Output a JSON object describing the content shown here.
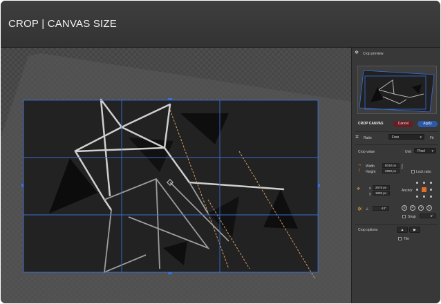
{
  "header": {
    "title": "CROP | CANVAS SIZE"
  },
  "panel": {
    "crop_preview_label": "Crop preview",
    "crop_canvas_label": "CROP CANVAS",
    "cancel_label": "Cancel",
    "apply_label": "Apply",
    "ratio_label": "Ratio",
    "ratio_value": "Free",
    "fit_label": "Fit",
    "crop_value_label": "Crop value",
    "unit_label": "Unit",
    "unit_value": "Pixel",
    "width_label": "Width",
    "width_value": "5010 px",
    "height_label": "Height",
    "height_value": "2980 px",
    "lock_ratio_label": "Lock ratio",
    "x_label": "x",
    "x_value": "2575 px",
    "y_label": "y",
    "y_value": "1805 px",
    "anchor_label": "Anchor",
    "angle_value": "-10°",
    "snap_label": "Snap",
    "snap_value": "5°",
    "crop_options_label": "Crop options",
    "tile_label": "Tile"
  },
  "colors": {
    "accent": "#2a5aa8",
    "cancel": "#6a1c22",
    "icon": "#e59f3d",
    "guide": "#3a6fd8"
  }
}
